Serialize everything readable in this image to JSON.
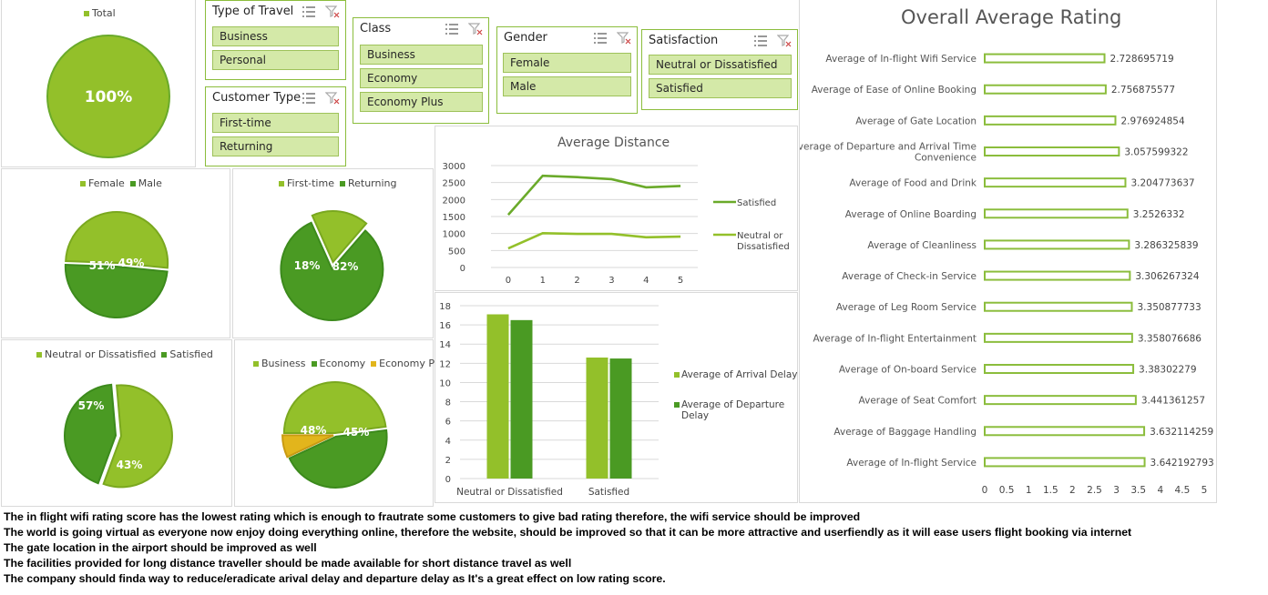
{
  "colors": {
    "light_green": "#93c02a",
    "mid_green": "#6aaa2a",
    "dark_green": "#4a9a23",
    "gold": "#e2b51c",
    "slicer_bg": "#d4e9a8",
    "slicer_border": "#8bbd3c"
  },
  "total_pie": {
    "legend": "Total",
    "label": "100%"
  },
  "slicers": {
    "type_of_travel": {
      "title": "Type of Travel",
      "items": [
        "Business",
        "Personal"
      ]
    },
    "customer_type": {
      "title": "Customer Type",
      "items": [
        "First-time",
        "Returning"
      ]
    },
    "class": {
      "title": "Class",
      "items": [
        "Business",
        "Economy",
        "Economy Plus"
      ]
    },
    "gender": {
      "title": "Gender",
      "items": [
        "Female",
        "Male"
      ]
    },
    "satisfaction": {
      "title": "Satisfaction",
      "items": [
        "Neutral or Dissatisfied",
        "Satisfied"
      ]
    }
  },
  "gender_pie": {
    "legend": [
      "Female",
      "Male"
    ],
    "labels": [
      "51%",
      "49%"
    ],
    "values": [
      51,
      49
    ]
  },
  "customer_pie": {
    "legend": [
      "First-time",
      "Returning"
    ],
    "labels": [
      "18%",
      "82%"
    ],
    "values": [
      18,
      82
    ]
  },
  "satisfaction_pie": {
    "legend": [
      "Neutral or Dissatisfied",
      "Satisfied"
    ],
    "labels": [
      "57%",
      "43%"
    ],
    "values": [
      57,
      43
    ]
  },
  "class_pie": {
    "legend": [
      "Business",
      "Economy",
      "Economy Plus"
    ],
    "labels": [
      "48%",
      "45%"
    ],
    "values": [
      48,
      45,
      7
    ]
  },
  "chart_data": [
    {
      "type": "line",
      "title": "Average Distance",
      "x": [
        0,
        1,
        2,
        3,
        4,
        5
      ],
      "ylim": [
        0,
        3000
      ],
      "yticks": [
        "3000",
        "2500",
        "2000",
        "1500",
        "1000",
        "500",
        "0"
      ],
      "series": [
        {
          "name": "Satisfied",
          "values": [
            1550,
            2700,
            2660,
            2600,
            2360,
            2400
          ]
        },
        {
          "name": "Neutral or Dissatisfied",
          "values": [
            560,
            1010,
            990,
            990,
            890,
            910
          ]
        }
      ]
    },
    {
      "type": "bar",
      "title": "",
      "categories": [
        "Neutral or Dissatisfied",
        "Satisfied"
      ],
      "ylim": [
        0,
        18
      ],
      "yticks": [
        "18",
        "16",
        "14",
        "12",
        "10",
        "8",
        "6",
        "4",
        "2",
        "0"
      ],
      "series": [
        {
          "name": "Average of Arrival Delay",
          "values": [
            17.1,
            12.6
          ]
        },
        {
          "name": "Average of Departure Delay",
          "values": [
            16.5,
            12.5
          ]
        }
      ]
    },
    {
      "type": "bar",
      "title": "Overall Average Rating",
      "xlim": [
        0,
        5
      ],
      "xticks": [
        "0",
        "0.5",
        "1",
        "1.5",
        "2",
        "2.5",
        "3",
        "3.5",
        "4",
        "4.5",
        "5"
      ],
      "categories": [
        "Average of In-flight Wifi Service",
        "Average of Ease of Online Booking",
        "Average of Gate Location",
        "Average of Departure and Arrival Time|Convenience",
        "Average of Food and Drink",
        "Average of Online Boarding",
        "Average of Cleanliness",
        "Average of Check-in Service",
        "Average of Leg Room Service",
        "Average of In-flight Entertainment",
        "Average of On-board Service",
        "Average of Seat Comfort",
        "Average of Baggage Handling",
        "Average of In-flight Service"
      ],
      "values": [
        2.728695719,
        2.756875577,
        2.976924854,
        3.057599322,
        3.204773637,
        3.2526332,
        3.286325839,
        3.306267324,
        3.350877733,
        3.358076686,
        3.38302279,
        3.441361257,
        3.632114259,
        3.642192793
      ],
      "value_labels": [
        "2.728695719",
        "2.756875577",
        "2.976924854",
        "3.057599322",
        "3.204773637",
        "3.2526332",
        "3.286325839",
        "3.306267324",
        "3.350877733",
        "3.358076686",
        "3.38302279",
        "3.441361257",
        "3.632114259",
        "3.642192793"
      ]
    }
  ],
  "notes": [
    "The in flight wifi rating score has the lowest rating which is enough to frautrate some customers to give bad rating therefore, the wifi service should be improved",
    "The world is going virtual as everyone now enjoy doing everything online, therefore the website, should be improved so that it can be more attractive and userfiendly as it will ease users flight booking via internet",
    "The gate location in the airport should be improved as well",
    "The facilities provided for long distance traveller should be made available for short distance travel as well",
    "The company should finda way to reduce/eradicate arival delay and departure delay as It's a great effect on low rating score."
  ]
}
